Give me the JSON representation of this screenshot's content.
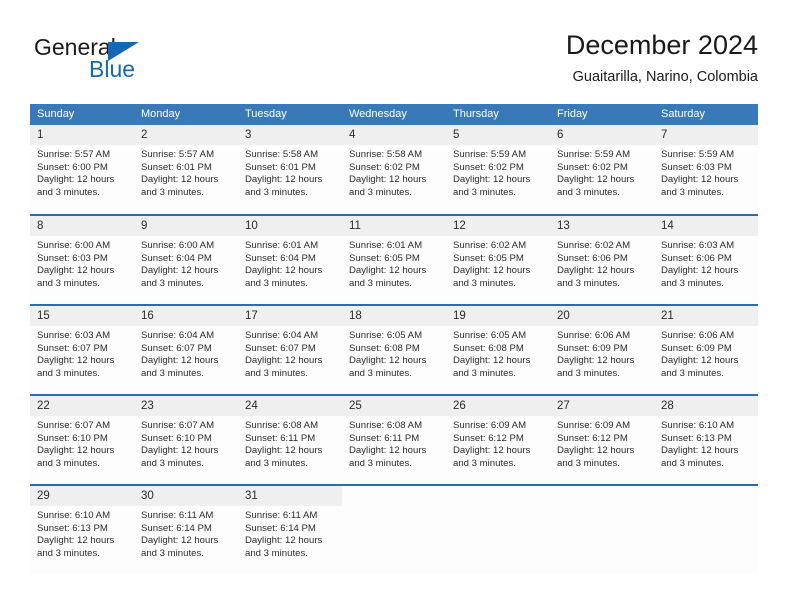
{
  "brand": {
    "name_part1": "General",
    "name_part2": "Blue",
    "accent_color": "#1569b4"
  },
  "header": {
    "month_title": "December 2024",
    "location": "Guaitarilla, Narino, Colombia"
  },
  "calendar": {
    "header_bg": "#3a79b8",
    "row_separator_color": "#2b6cb0",
    "daynum_bg": "#efefef",
    "weekday_headers": [
      "Sunday",
      "Monday",
      "Tuesday",
      "Wednesday",
      "Thursday",
      "Friday",
      "Saturday"
    ],
    "weeks": [
      [
        {
          "day": "1",
          "sunrise": "Sunrise: 5:57 AM",
          "sunset": "Sunset: 6:00 PM",
          "daylight_line1": "Daylight: 12 hours",
          "daylight_line2": "and 3 minutes."
        },
        {
          "day": "2",
          "sunrise": "Sunrise: 5:57 AM",
          "sunset": "Sunset: 6:01 PM",
          "daylight_line1": "Daylight: 12 hours",
          "daylight_line2": "and 3 minutes."
        },
        {
          "day": "3",
          "sunrise": "Sunrise: 5:58 AM",
          "sunset": "Sunset: 6:01 PM",
          "daylight_line1": "Daylight: 12 hours",
          "daylight_line2": "and 3 minutes."
        },
        {
          "day": "4",
          "sunrise": "Sunrise: 5:58 AM",
          "sunset": "Sunset: 6:02 PM",
          "daylight_line1": "Daylight: 12 hours",
          "daylight_line2": "and 3 minutes."
        },
        {
          "day": "5",
          "sunrise": "Sunrise: 5:59 AM",
          "sunset": "Sunset: 6:02 PM",
          "daylight_line1": "Daylight: 12 hours",
          "daylight_line2": "and 3 minutes."
        },
        {
          "day": "6",
          "sunrise": "Sunrise: 5:59 AM",
          "sunset": "Sunset: 6:02 PM",
          "daylight_line1": "Daylight: 12 hours",
          "daylight_line2": "and 3 minutes."
        },
        {
          "day": "7",
          "sunrise": "Sunrise: 5:59 AM",
          "sunset": "Sunset: 6:03 PM",
          "daylight_line1": "Daylight: 12 hours",
          "daylight_line2": "and 3 minutes."
        }
      ],
      [
        {
          "day": "8",
          "sunrise": "Sunrise: 6:00 AM",
          "sunset": "Sunset: 6:03 PM",
          "daylight_line1": "Daylight: 12 hours",
          "daylight_line2": "and 3 minutes."
        },
        {
          "day": "9",
          "sunrise": "Sunrise: 6:00 AM",
          "sunset": "Sunset: 6:04 PM",
          "daylight_line1": "Daylight: 12 hours",
          "daylight_line2": "and 3 minutes."
        },
        {
          "day": "10",
          "sunrise": "Sunrise: 6:01 AM",
          "sunset": "Sunset: 6:04 PM",
          "daylight_line1": "Daylight: 12 hours",
          "daylight_line2": "and 3 minutes."
        },
        {
          "day": "11",
          "sunrise": "Sunrise: 6:01 AM",
          "sunset": "Sunset: 6:05 PM",
          "daylight_line1": "Daylight: 12 hours",
          "daylight_line2": "and 3 minutes."
        },
        {
          "day": "12",
          "sunrise": "Sunrise: 6:02 AM",
          "sunset": "Sunset: 6:05 PM",
          "daylight_line1": "Daylight: 12 hours",
          "daylight_line2": "and 3 minutes."
        },
        {
          "day": "13",
          "sunrise": "Sunrise: 6:02 AM",
          "sunset": "Sunset: 6:06 PM",
          "daylight_line1": "Daylight: 12 hours",
          "daylight_line2": "and 3 minutes."
        },
        {
          "day": "14",
          "sunrise": "Sunrise: 6:03 AM",
          "sunset": "Sunset: 6:06 PM",
          "daylight_line1": "Daylight: 12 hours",
          "daylight_line2": "and 3 minutes."
        }
      ],
      [
        {
          "day": "15",
          "sunrise": "Sunrise: 6:03 AM",
          "sunset": "Sunset: 6:07 PM",
          "daylight_line1": "Daylight: 12 hours",
          "daylight_line2": "and 3 minutes."
        },
        {
          "day": "16",
          "sunrise": "Sunrise: 6:04 AM",
          "sunset": "Sunset: 6:07 PM",
          "daylight_line1": "Daylight: 12 hours",
          "daylight_line2": "and 3 minutes."
        },
        {
          "day": "17",
          "sunrise": "Sunrise: 6:04 AM",
          "sunset": "Sunset: 6:07 PM",
          "daylight_line1": "Daylight: 12 hours",
          "daylight_line2": "and 3 minutes."
        },
        {
          "day": "18",
          "sunrise": "Sunrise: 6:05 AM",
          "sunset": "Sunset: 6:08 PM",
          "daylight_line1": "Daylight: 12 hours",
          "daylight_line2": "and 3 minutes."
        },
        {
          "day": "19",
          "sunrise": "Sunrise: 6:05 AM",
          "sunset": "Sunset: 6:08 PM",
          "daylight_line1": "Daylight: 12 hours",
          "daylight_line2": "and 3 minutes."
        },
        {
          "day": "20",
          "sunrise": "Sunrise: 6:06 AM",
          "sunset": "Sunset: 6:09 PM",
          "daylight_line1": "Daylight: 12 hours",
          "daylight_line2": "and 3 minutes."
        },
        {
          "day": "21",
          "sunrise": "Sunrise: 6:06 AM",
          "sunset": "Sunset: 6:09 PM",
          "daylight_line1": "Daylight: 12 hours",
          "daylight_line2": "and 3 minutes."
        }
      ],
      [
        {
          "day": "22",
          "sunrise": "Sunrise: 6:07 AM",
          "sunset": "Sunset: 6:10 PM",
          "daylight_line1": "Daylight: 12 hours",
          "daylight_line2": "and 3 minutes."
        },
        {
          "day": "23",
          "sunrise": "Sunrise: 6:07 AM",
          "sunset": "Sunset: 6:10 PM",
          "daylight_line1": "Daylight: 12 hours",
          "daylight_line2": "and 3 minutes."
        },
        {
          "day": "24",
          "sunrise": "Sunrise: 6:08 AM",
          "sunset": "Sunset: 6:11 PM",
          "daylight_line1": "Daylight: 12 hours",
          "daylight_line2": "and 3 minutes."
        },
        {
          "day": "25",
          "sunrise": "Sunrise: 6:08 AM",
          "sunset": "Sunset: 6:11 PM",
          "daylight_line1": "Daylight: 12 hours",
          "daylight_line2": "and 3 minutes."
        },
        {
          "day": "26",
          "sunrise": "Sunrise: 6:09 AM",
          "sunset": "Sunset: 6:12 PM",
          "daylight_line1": "Daylight: 12 hours",
          "daylight_line2": "and 3 minutes."
        },
        {
          "day": "27",
          "sunrise": "Sunrise: 6:09 AM",
          "sunset": "Sunset: 6:12 PM",
          "daylight_line1": "Daylight: 12 hours",
          "daylight_line2": "and 3 minutes."
        },
        {
          "day": "28",
          "sunrise": "Sunrise: 6:10 AM",
          "sunset": "Sunset: 6:13 PM",
          "daylight_line1": "Daylight: 12 hours",
          "daylight_line2": "and 3 minutes."
        }
      ],
      [
        {
          "day": "29",
          "sunrise": "Sunrise: 6:10 AM",
          "sunset": "Sunset: 6:13 PM",
          "daylight_line1": "Daylight: 12 hours",
          "daylight_line2": "and 3 minutes."
        },
        {
          "day": "30",
          "sunrise": "Sunrise: 6:11 AM",
          "sunset": "Sunset: 6:14 PM",
          "daylight_line1": "Daylight: 12 hours",
          "daylight_line2": "and 3 minutes."
        },
        {
          "day": "31",
          "sunrise": "Sunrise: 6:11 AM",
          "sunset": "Sunset: 6:14 PM",
          "daylight_line1": "Daylight: 12 hours",
          "daylight_line2": "and 3 minutes."
        },
        {
          "day": "",
          "sunrise": "",
          "sunset": "",
          "daylight_line1": "",
          "daylight_line2": ""
        },
        {
          "day": "",
          "sunrise": "",
          "sunset": "",
          "daylight_line1": "",
          "daylight_line2": ""
        },
        {
          "day": "",
          "sunrise": "",
          "sunset": "",
          "daylight_line1": "",
          "daylight_line2": ""
        },
        {
          "day": "",
          "sunrise": "",
          "sunset": "",
          "daylight_line1": "",
          "daylight_line2": ""
        }
      ]
    ]
  }
}
